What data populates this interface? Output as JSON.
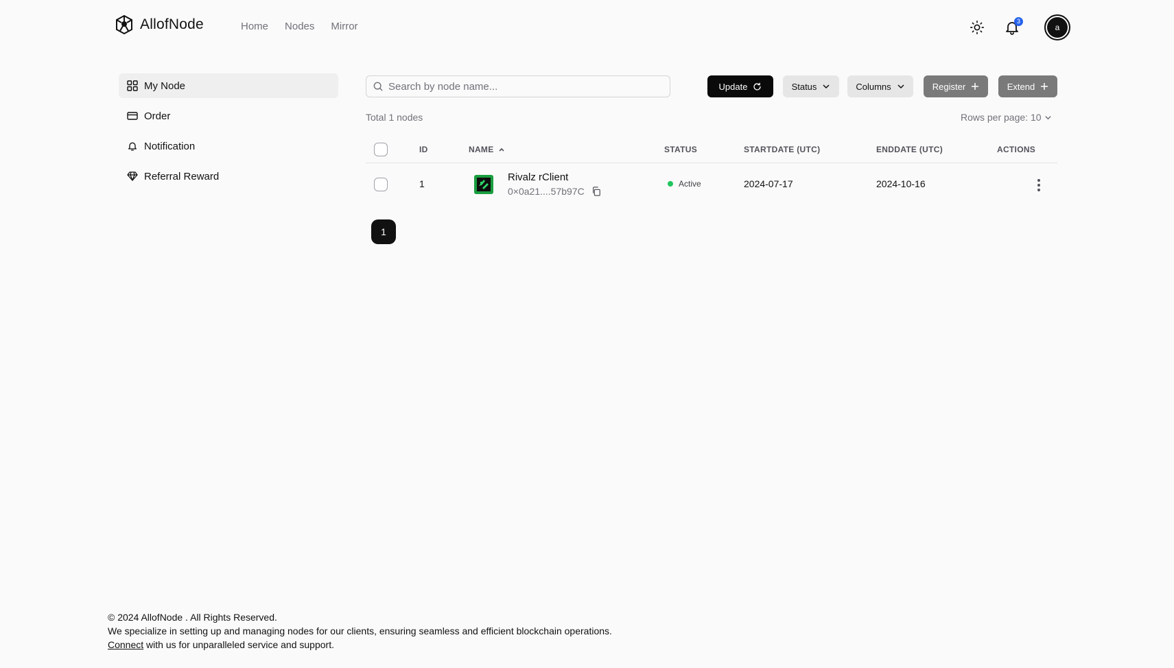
{
  "header": {
    "brand": "AllofNode",
    "nav": [
      "Home",
      "Nodes",
      "Mirror"
    ],
    "notification_count": "3",
    "avatar_initial": "a"
  },
  "sidebar": {
    "items": [
      {
        "label": "My Node",
        "icon": "grid-icon",
        "active": true
      },
      {
        "label": "Order",
        "icon": "card-icon",
        "active": false
      },
      {
        "label": "Notification",
        "icon": "bell-icon",
        "active": false
      },
      {
        "label": "Referral Reward",
        "icon": "diamond-icon",
        "active": false
      }
    ]
  },
  "toolbar": {
    "search_placeholder": "Search by node name...",
    "update_label": "Update",
    "status_label": "Status",
    "columns_label": "Columns",
    "register_label": "Register",
    "extend_label": "Extend"
  },
  "summary": {
    "total_text": "Total 1 nodes",
    "rows_per_page": "Rows per page: 10"
  },
  "table": {
    "headers": {
      "id": "ID",
      "name": "NAME",
      "status": "STATUS",
      "startdate": "STARTDATE (UTC)",
      "enddate": "ENDDATE (UTC)",
      "actions": "ACTIONS"
    },
    "rows": [
      {
        "id": "1",
        "name": "Rivalz rClient",
        "address": "0×0a21....57b97C",
        "status": "Active",
        "startdate": "2024-07-17",
        "enddate": "2024-10-16"
      }
    ]
  },
  "pagination": {
    "current_page": "1"
  },
  "footer": {
    "copyright": "© 2024 AllofNode . All Rights Reserved.",
    "tagline": "We specialize in setting up and managing nodes for our clients, ensuring seamless and efficient blockchain operations.",
    "connect_link": "Connect",
    "connect_rest": " with us for unparalleled service and support."
  },
  "colors": {
    "status_active": "#22c55e",
    "badge": "#2563eb",
    "primary_button": "#0a0a0a"
  }
}
